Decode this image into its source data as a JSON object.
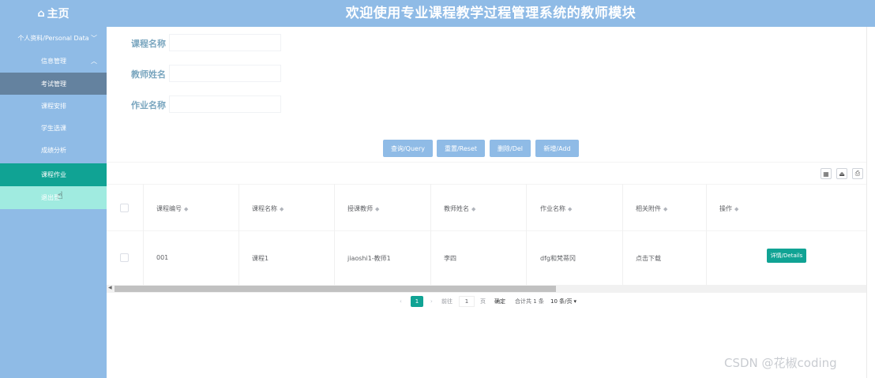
{
  "header": {
    "home_label": "主页",
    "title": "欢迎使用专业课程教学过程管理系统的教师模块"
  },
  "sidebar": {
    "personal": "个人资料/Personal Data",
    "info": "信息管理",
    "items": [
      {
        "label": "考试管理"
      },
      {
        "label": "课程安排"
      },
      {
        "label": "学生选课"
      },
      {
        "label": "成绩分析"
      },
      {
        "label": "课程作业"
      },
      {
        "label": "退出登"
      }
    ]
  },
  "search": {
    "course_name_label": "课程名称",
    "teacher_name_label": "教师姓名",
    "homework_name_label": "作业名称"
  },
  "buttons": {
    "query": "查询/Query",
    "reset": "重置/Reset",
    "delete": "删除/Del",
    "add": "新增/Add"
  },
  "table": {
    "columns": [
      "课程编号",
      "课程名称",
      "授课教师",
      "教师姓名",
      "作业名称",
      "相关附件",
      "操作"
    ],
    "rows": [
      {
        "code": "001",
        "course": "课程1",
        "teacher_account": "jiaoshi1-教师1",
        "teacher_name": "李四",
        "homework": "dfg和梵蒂冈",
        "attachment": "点击下载",
        "action": "详情/Details"
      }
    ]
  },
  "pagination": {
    "prev": "‹",
    "current": "1",
    "next": "›",
    "goto": "前往",
    "goto_value": "1",
    "page_unit": "页",
    "confirm": "确定",
    "total": "合计共 1 条",
    "page_size": "10 条/页"
  },
  "watermark": "CSDN @花椒coding",
  "colors": {
    "primary": "#8fbbe6",
    "accent": "#10a394",
    "active_menu": "#64829f"
  }
}
